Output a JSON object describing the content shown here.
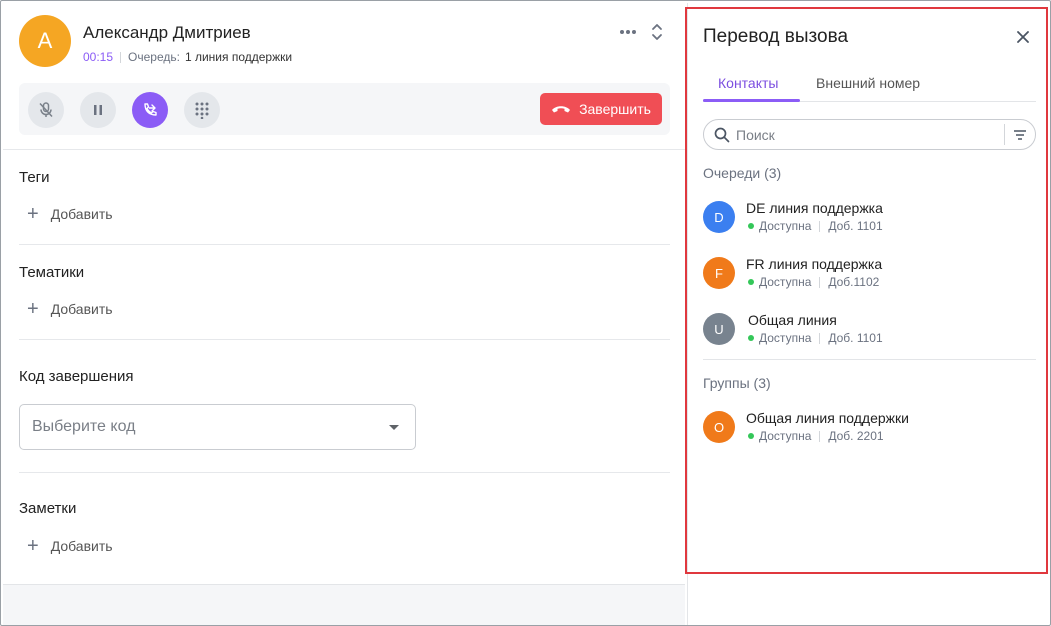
{
  "call": {
    "avatar_letter": "A",
    "caller_name": "Александр Дмитриев",
    "timer": "00:15",
    "queue_label": "Очередь:",
    "queue_value": "1 линия поддержки",
    "end_label": "Завершить"
  },
  "sections": {
    "tags_title": "Теги",
    "topics_title": "Тематики",
    "code_title": "Код завершения",
    "notes_title": "Заметки",
    "add_label": "Добавить",
    "code_placeholder": "Выберите код"
  },
  "transfer": {
    "title": "Перевод вызова",
    "tabs": [
      {
        "label": "Контакты",
        "active": true
      },
      {
        "label": "Внешний номер",
        "active": false
      }
    ],
    "search_placeholder": "Поиск",
    "queues_label": "Очереди (3)",
    "groups_label": "Группы (3)",
    "queues": [
      {
        "letter": "D",
        "name": "DE линия поддержка",
        "status": "Доступна",
        "ext": "Доб. 1101",
        "color": "#3b7ff0"
      },
      {
        "letter": "F",
        "name": "FR линия поддержка",
        "status": "Доступна",
        "ext": "Доб.1102",
        "color": "#f07a1a"
      },
      {
        "letter": "U",
        "name": "Общая линия",
        "status": "Доступна",
        "ext": "Доб. 1101",
        "color": "#78838f"
      }
    ],
    "groups": [
      {
        "letter": "O",
        "name": "Общая линия поддержки",
        "status": "Доступна",
        "ext": "Доб. 2201",
        "color": "#f07a1a"
      }
    ]
  },
  "colors": {
    "accent": "#8b5cf6",
    "end_call": "#f04e55",
    "available": "#34c759",
    "highlight": "#e0383e"
  }
}
